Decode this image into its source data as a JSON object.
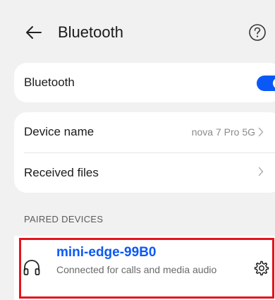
{
  "header": {
    "title": "Bluetooth",
    "back_icon": "back-arrow-icon",
    "help_icon": "help-icon"
  },
  "bluetooth_card": {
    "label": "Bluetooth",
    "toggle_on": true,
    "toggle_color": "#0a59f7"
  },
  "device_card": {
    "rows": [
      {
        "label": "Device name",
        "value": "nova 7 Pro 5G"
      },
      {
        "label": "Received files",
        "value": ""
      }
    ]
  },
  "paired": {
    "section_title": "PAIRED DEVICES",
    "devices": [
      {
        "name": "mini-edge-99B0",
        "status": "Connected for calls and media audio",
        "icon": "headphones-icon",
        "settings_icon": "gear-icon"
      }
    ],
    "highlight_color": "#e5141c"
  }
}
